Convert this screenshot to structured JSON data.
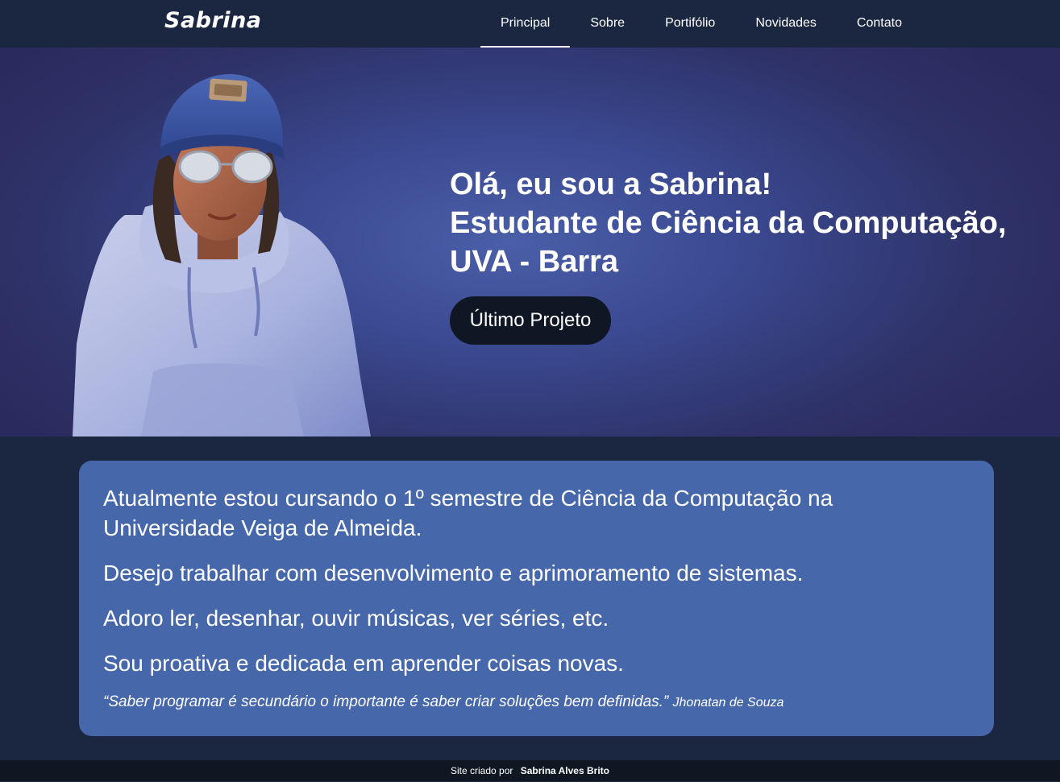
{
  "brand": "Sabrina",
  "nav": {
    "items": [
      {
        "label": "Principal",
        "active": true
      },
      {
        "label": "Sobre",
        "active": false
      },
      {
        "label": "Portifólio",
        "active": false
      },
      {
        "label": "Novidades",
        "active": false
      },
      {
        "label": "Contato",
        "active": false
      }
    ]
  },
  "hero": {
    "headline_line1": "Olá, eu sou a Sabrina!",
    "headline_line2": "Estudante de Ciência da Computação,",
    "headline_line3": "UVA - Barra",
    "cta_label": "Último Projeto",
    "avatar_icon": "avatar-illustration"
  },
  "about": {
    "paragraphs": [
      "Atualmente estou cursando o 1º semestre de Ciência da Computação na Universidade Veiga de Almeida.",
      "Desejo trabalhar com desenvolvimento e aprimoramento de sistemas.",
      "Adoro ler, desenhar, ouvir músicas, ver séries, etc.",
      "Sou proativa e dedicada em aprender coisas novas."
    ],
    "quote_text": "“Saber programar é secundário o importante é saber criar soluções bem definidas.”",
    "quote_author": "Jhonatan de Souza"
  },
  "footer": {
    "prefix": "Site criado por",
    "name": "Sabrina Alves Brito"
  },
  "colors": {
    "navbar": "#1b2641",
    "hero_center": "#4a5fa8",
    "card": "#4667a9",
    "button": "#0f1624",
    "footer": "#0f1722"
  }
}
